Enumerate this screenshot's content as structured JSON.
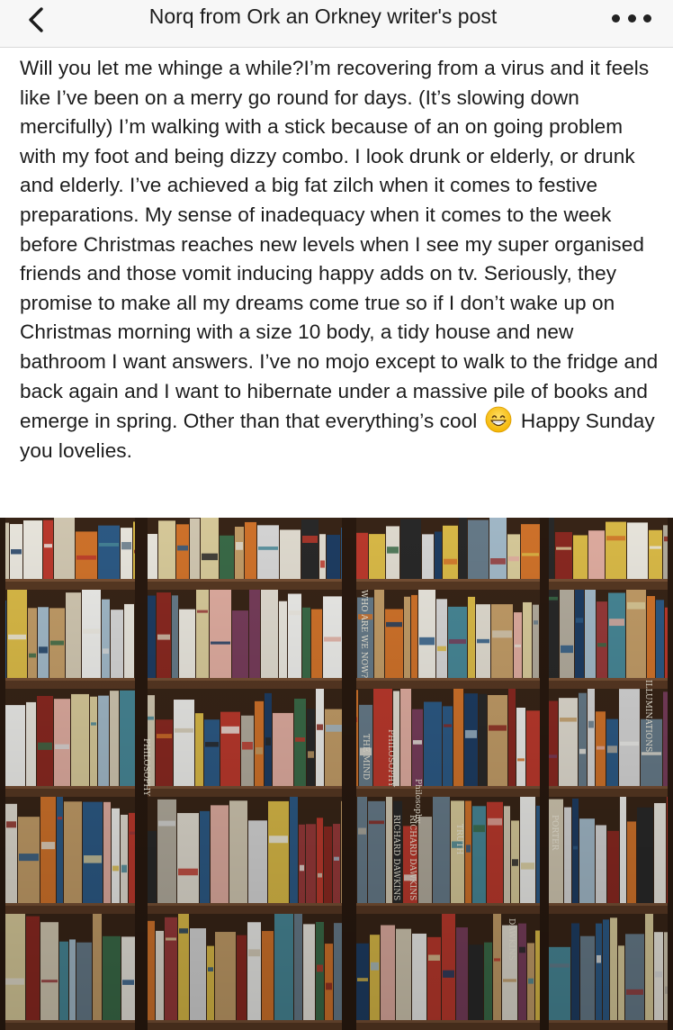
{
  "navbar": {
    "back_icon": "chevron-left-icon",
    "title": "Norq from Ork  an Orkney writer's post",
    "more_icon": "more-horizontal-icon"
  },
  "post": {
    "text_before_emoji": "Will you let me whinge a while?I’m recovering from a virus and it feels like I’ve been on a merry go round for days. (It’s slowing down mercifully) I’m walking with a stick because of an on going problem with my foot and being dizzy combo. I look drunk or elderly, or drunk and elderly. I’ve achieved a big fat zilch when it comes to festive preparations. My sense of inadequacy when it comes to the week before Christmas reaches new levels when I see my super organised friends and those vomit inducing happy adds on tv. Seriously, they promise to make all my dreams come true so if I don’t wake up on Christmas morning with a size 10 body, a tidy house and new bathroom I want answers. I’ve no mojo except to walk to the fridge and back again and I want to hibernate under a massive pile of books and emerge in spring. Other than that everything’s cool",
    "emoji": "grinning-face-emoji",
    "text_after_emoji": "Happy Sunday you lovelies."
  },
  "photo": {
    "subject": "bookshelf-photo",
    "spine_texts": [
      "THE MIND",
      "PHILOSOPHY",
      "RICHARD DAWKINS",
      "RICHARD DAWKINS",
      "TRUTH",
      "PHILOSOPHY",
      "PORTER",
      "ILLUMINATIONS",
      "WHO ARE WE NOW?",
      "Philosophy",
      "DAWKINS",
      "Kafka"
    ],
    "colors": {
      "wood": "#5a3a24",
      "wood_dark": "#2a1a10",
      "wood_light": "#7a5236"
    }
  }
}
